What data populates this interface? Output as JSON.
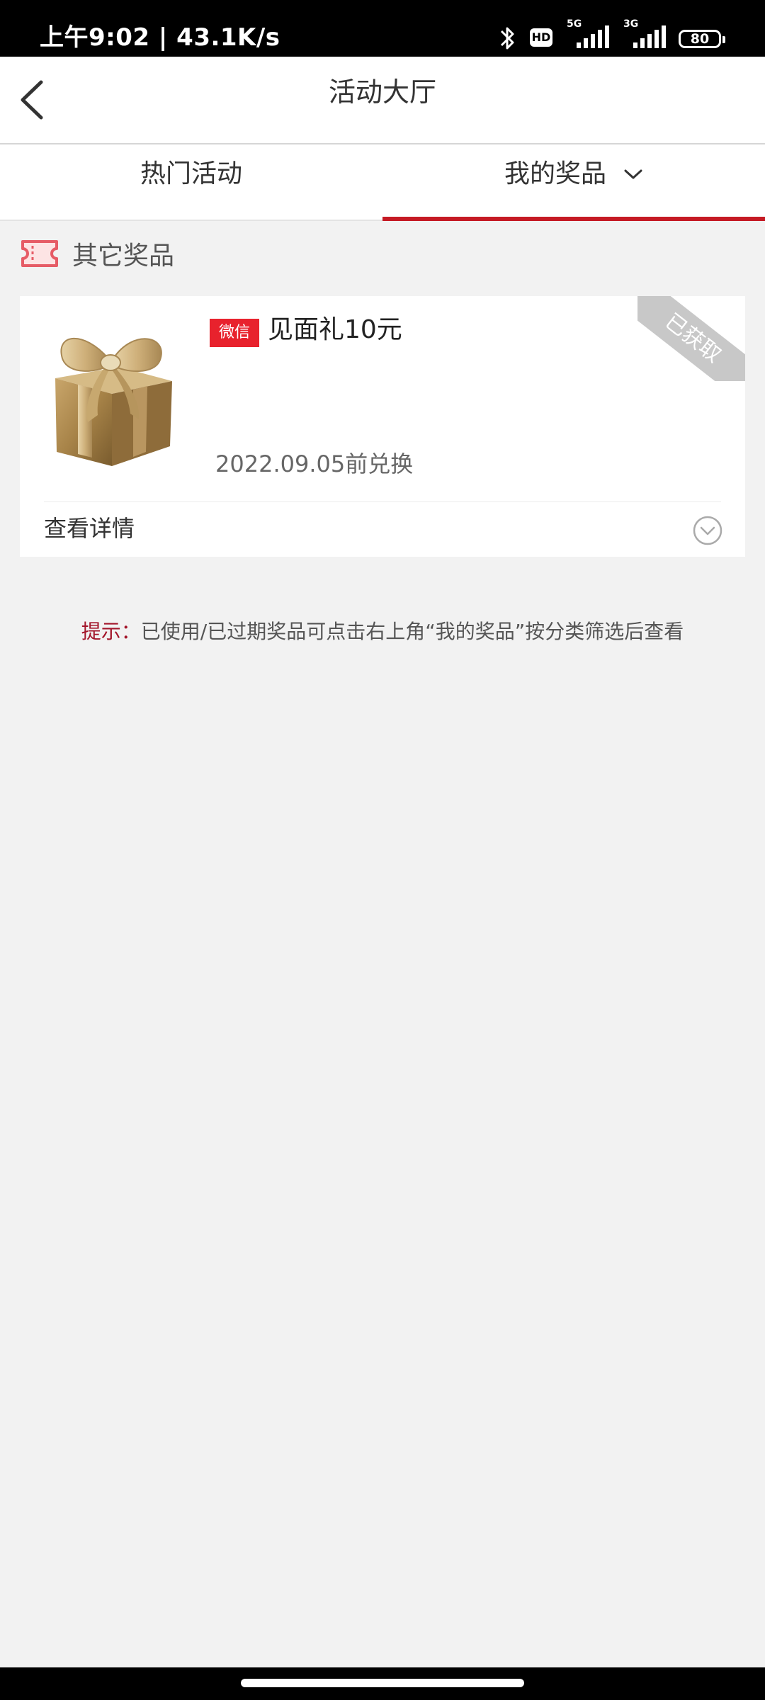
{
  "status_bar": {
    "time_speed": "上午9:02 | 43.1K/s",
    "hd": "HD",
    "net1": "5G",
    "net2": "3G",
    "battery": "80"
  },
  "nav": {
    "title": "活动大厅"
  },
  "tabs": [
    {
      "label": "热门活动",
      "active": false
    },
    {
      "label": "我的奖品",
      "active": true
    }
  ],
  "section": {
    "title": "其它奖品"
  },
  "prize": {
    "badge": "微信",
    "name": "见面礼10元",
    "expiry": "2022.09.05前兑换",
    "status": "已获取",
    "details_label": "查看详情"
  },
  "tip": {
    "label": "提示：",
    "text": "已使用/已过期奖品可点击右上角“我的奖品”按分类筛选后查看"
  },
  "colors": {
    "accent": "#c51a24",
    "badge": "#e8222d",
    "tip_label": "#a3152a",
    "background": "#f2f2f2"
  },
  "icons": {
    "back": "back-arrow-icon",
    "tab_dropdown": "chevron-down-icon",
    "section": "ticket-icon",
    "gift": "gift-box-icon",
    "details": "chevron-down-circle-icon"
  }
}
